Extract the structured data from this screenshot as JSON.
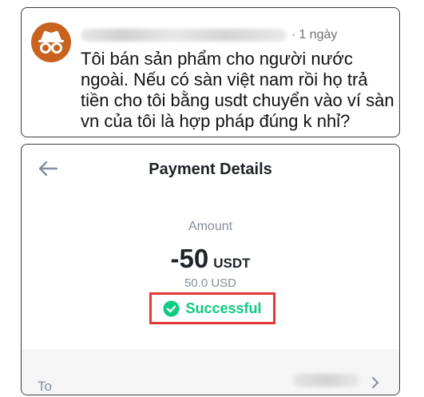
{
  "comment": {
    "author_name": "",
    "separator": "·",
    "time": "1 ngày",
    "text": "Tôi bán sản phẩm cho người nước ngoài. Nếu có sàn việt nam rồi họ trả tiền cho tôi bằng usdt chuyển vào ví sàn vn của tôi là hợp pháp đúng k nhỉ?",
    "avatar_icon": "incognito-icon",
    "avatar_color": "#c8631f"
  },
  "payment": {
    "title": "Payment Details",
    "amount_label": "Amount",
    "amount_value": "-50",
    "amount_unit": "USDT",
    "usd_value": "50.0 USD",
    "status_text": "Successful",
    "status_color": "#0ecb81",
    "highlight_color": "#e53935",
    "to_label": "To",
    "back_icon": "arrow-left-icon",
    "status_icon": "check-circle-icon",
    "chevron_icon": "chevron-right-icon"
  }
}
